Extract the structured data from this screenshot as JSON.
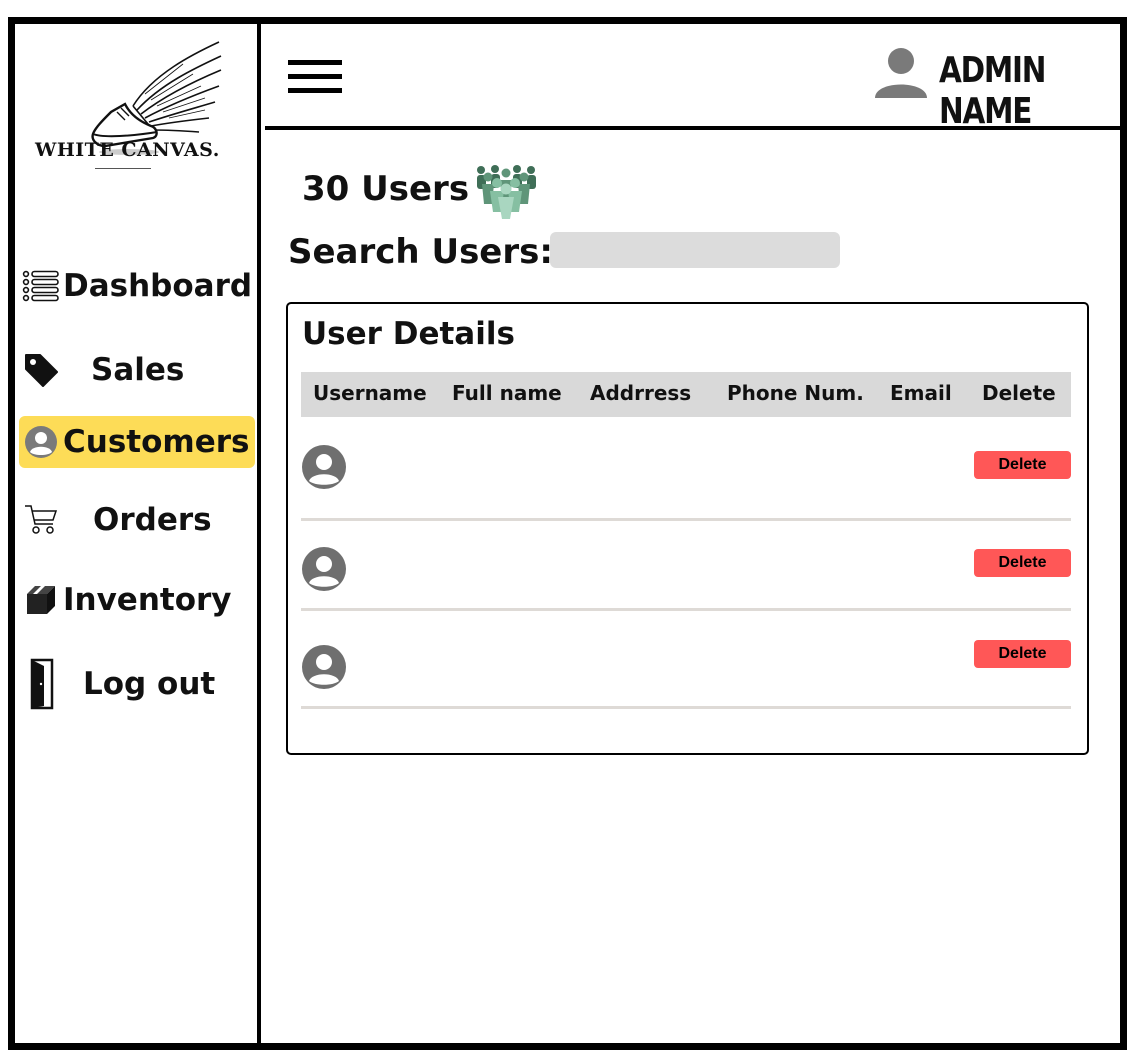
{
  "brand": {
    "name": "WHITE CANVAS."
  },
  "header": {
    "admin_name": "ADMIN NAME"
  },
  "sidebar": {
    "items": [
      {
        "label": "Dashboard",
        "icon": "list-icon",
        "active": false
      },
      {
        "label": "Sales",
        "icon": "tag-icon",
        "active": false
      },
      {
        "label": "Customers",
        "icon": "user-circle-icon",
        "active": true
      },
      {
        "label": "Orders",
        "icon": "cart-icon",
        "active": false
      },
      {
        "label": "Inventory",
        "icon": "box-icon",
        "active": false
      },
      {
        "label": "Log out",
        "icon": "door-icon",
        "active": false
      }
    ]
  },
  "main": {
    "users_count": "30 Users",
    "search_label": "Search Users:",
    "search_value": "",
    "panel_title": "User Details",
    "columns": [
      "Username",
      "Full name",
      "Addrress",
      "Phone Num.",
      "Email",
      "Delete"
    ],
    "rows": [
      {
        "delete_label": "Delete"
      },
      {
        "delete_label": "Delete"
      },
      {
        "delete_label": "Delete"
      }
    ]
  },
  "colors": {
    "active_nav": "#fddc57",
    "delete_button": "#ff5757",
    "table_header": "#d9d9d9",
    "search_field": "#dcdcdc"
  }
}
